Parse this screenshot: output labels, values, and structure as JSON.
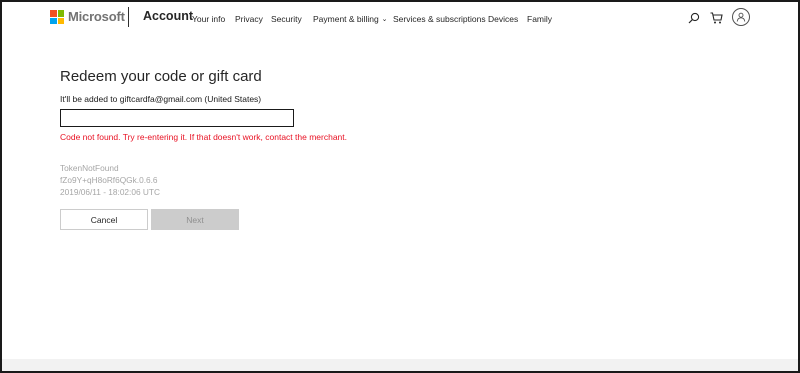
{
  "header": {
    "brand": "Microsoft",
    "section": "Account",
    "nav": [
      {
        "label": "Your info"
      },
      {
        "label": "Privacy"
      },
      {
        "label": "Security"
      },
      {
        "label": "Payment & billing"
      },
      {
        "label": "Services & subscriptions"
      },
      {
        "label": "Devices"
      },
      {
        "label": "Family"
      }
    ],
    "icons": [
      "search-icon",
      "cart-icon",
      "user-avatar-icon"
    ]
  },
  "main": {
    "title": "Redeem your code or gift card",
    "subtitle": "It'll be added to giftcardfa@gmail.com (United States)",
    "code_input": {
      "value": "",
      "placeholder": ""
    },
    "error": "Code not found. Try re-entering it. If that doesn't work, contact the merchant.",
    "diagnostics": [
      "TokenNotFound",
      "fZo9Y+qH8oRf6QGk.0.6.6",
      "2019/06/11 - 18:02:06 UTC"
    ],
    "cancel_label": "Cancel",
    "next_label": "Next"
  },
  "colors": {
    "error": "#e81123",
    "muted_text": "#a6a6a6",
    "disabled_button": "#cccccc",
    "logo_red": "#f25022",
    "logo_green": "#7fba00",
    "logo_blue": "#00a4ef",
    "logo_yellow": "#ffb900"
  }
}
